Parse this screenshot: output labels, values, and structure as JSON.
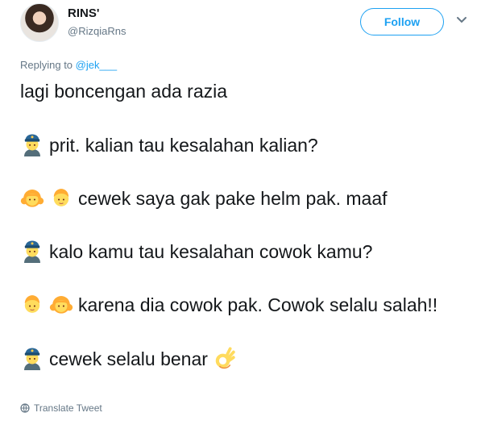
{
  "author": {
    "display_name": "RINS'",
    "handle": "@RizqiaRns"
  },
  "follow_button": {
    "label": "Follow"
  },
  "reply_context": {
    "prefix": "Replying to ",
    "mention": "@jek___"
  },
  "tweet": {
    "line1": "lagi boncengan ada razia",
    "line2": "prit. kalian tau kesalahan kalian?",
    "line3": "cewek saya gak pake helm pak. maaf",
    "line4": "kalo kamu tau kesalahan cowok kamu?",
    "line5": "karena dia cowok pak.  Cowok selalu salah!!",
    "line6": "cewek selalu benar"
  },
  "emojis": {
    "police": "police-officer-emoji",
    "girl": "girl-emoji",
    "boy": "boy-emoji",
    "ok_hand": "ok-hand-emoji"
  },
  "translate": {
    "label": "Translate Tweet"
  },
  "colors": {
    "accent": "#1da1f2",
    "secondary_text": "#657786",
    "text": "#14171a"
  }
}
